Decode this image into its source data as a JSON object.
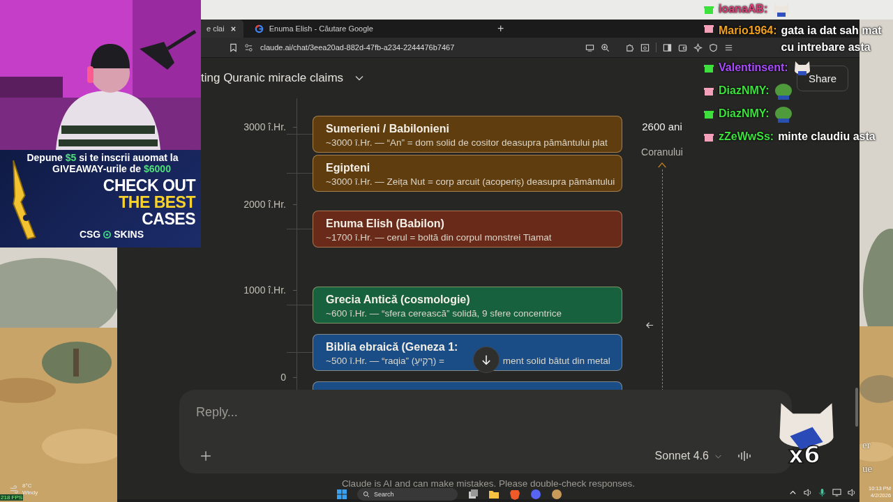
{
  "browser": {
    "tabs": [
      {
        "title": "e clai",
        "selected": true
      },
      {
        "title": "Enuma Elish - Căutare Google",
        "selected": false
      }
    ],
    "new_tab": "+",
    "url": "claude.ai/chat/3eea20ad-882d-47fb-a234-2244476b7467"
  },
  "chat_header": {
    "title": "ting Quranic miracle claims",
    "share": "Share"
  },
  "timeline": {
    "axis_labels": [
      "3000 î.Hr.",
      "2000 î.Hr.",
      "1000 î.Hr.",
      "0"
    ],
    "events": [
      {
        "title": "Sumerieni / Babilonieni",
        "subtitle": [
          "~3000 î.Hr. — “An” = dom solid de cositor deasupra pământului plat"
        ],
        "color": "#5f3d0f"
      },
      {
        "title": "Egipteni",
        "subtitle": [
          "~3000 î.Hr. — Zeița Nut = corp arcuit (acoperiș) deasupra pământului"
        ],
        "color": "#5f3d0f"
      },
      {
        "title": "Enuma Elish (Babilon)",
        "subtitle": [
          "~1700 î.Hr. — cerul = boltă din corpul monstrei Tiamat"
        ],
        "color": "#6a2a1a"
      },
      {
        "title": "Grecia Antică (cosmologie)",
        "subtitle": [
          "~600 î.Hr. — “sfera cerească” solidă, 9 sfere concentrice"
        ],
        "color": "#17613f"
      },
      {
        "title": "Biblia ebraică (Geneza 1:",
        "subtitle": [
          "~500 î.Hr. — “raqia” (רָקִיעַ) =",
          "ment solid bătut din metal"
        ],
        "color": "#1a4d85"
      },
      {
        "color": "#1a4d85"
      }
    ],
    "side_note": [
      "2600 ani",
      "Coranului"
    ]
  },
  "reply": {
    "placeholder": "Reply...",
    "model": "Sonnet 4.6"
  },
  "disclaimer": "Claude is AI and can make mistakes. Please double-check responses.",
  "stream_chat": [
    {
      "user": "ioanaAB:",
      "color": "#e0407a",
      "kind": "cat"
    },
    {
      "user": "Mario1964:",
      "color": "#f2a21e",
      "kind": "text",
      "message": "gata ia dat sah mat cu intrebare asta"
    },
    {
      "user": "Valentinsent:",
      "color": "#a94dff",
      "kind": "cat"
    },
    {
      "user": "DiazNMY:",
      "color": "#3ee03e",
      "kind": "frog"
    },
    {
      "user": "DiazNMY:",
      "color": "#3ee03e",
      "kind": "frog"
    },
    {
      "user": "zZeWwSs:",
      "color": "#3ee03e",
      "kind": "text",
      "message": "minte claudiu asta"
    }
  ],
  "emote_combo": "x6",
  "ad": {
    "line1": [
      {
        "text": "Depune ",
        "highlight": false
      },
      {
        "text": "$5",
        "highlight": true
      },
      {
        "text": " si te inscrii auomat la",
        "highlight": false
      }
    ],
    "line2": [
      {
        "text": "GIVEAWAY-urile de ",
        "highlight": false
      },
      {
        "text": "$6000",
        "highlight": true
      }
    ],
    "headline": [
      {
        "text": "CHECK OUT",
        "highlight": false
      },
      {
        "text": "THE BEST",
        "highlight": true
      },
      {
        "text": "CASES",
        "highlight": false
      }
    ],
    "brand": [
      "CSG",
      "SKINS"
    ]
  },
  "taskbar": {
    "search": "Search",
    "time": "10:13 PM",
    "date": "4/2/2026",
    "weather": {
      "temp": "8°C",
      "condition": "Windy"
    }
  },
  "fps": "218 FPS",
  "desktop_labels": [
    "er",
    "ue"
  ]
}
